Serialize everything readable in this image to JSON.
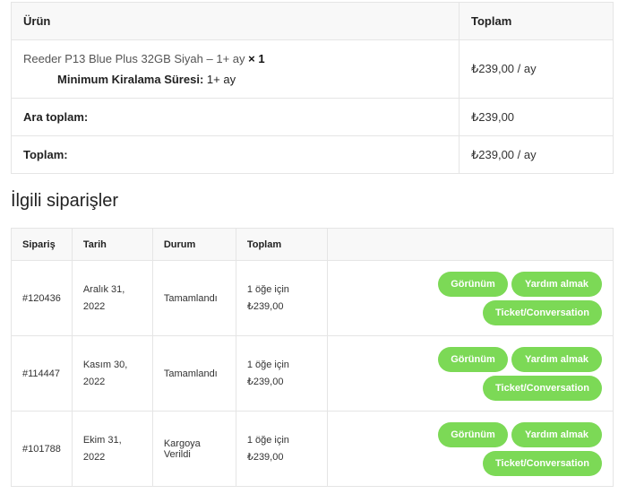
{
  "order": {
    "header": {
      "product": "Ürün",
      "total": "Toplam"
    },
    "item": {
      "name": "Reeder P13 Blue Plus 32GB Siyah – 1+ ay",
      "qty": "× 1",
      "meta_key": "Minimum Kiralama Süresi:",
      "meta_value": "1+ ay",
      "total": "₺239,00 / ay"
    },
    "subtotal": {
      "label": "Ara toplam:",
      "value": "₺239,00"
    },
    "total": {
      "label": "Toplam:",
      "value": "₺239,00 / ay"
    }
  },
  "related": {
    "title": "İlgili siparişler",
    "headers": {
      "order": "Sipariş",
      "date": "Tarih",
      "status": "Durum",
      "total": "Toplam"
    },
    "buttons": {
      "view": "Görünüm",
      "help": "Yardım almak",
      "ticket": "Ticket/Conversation"
    },
    "rows": [
      {
        "number": "#120436",
        "date_line1": "Aralık 31,",
        "date_line2": "2022",
        "status": "Tamamlandı",
        "items": "1 öğe için",
        "amount": "₺239,00"
      },
      {
        "number": "#114447",
        "date_line1": "Kasım 30,",
        "date_line2": "2022",
        "status": "Tamamlandı",
        "items": "1 öğe için",
        "amount": "₺239,00"
      },
      {
        "number": "#101788",
        "date_line1": "Ekim 31, 2022",
        "date_line2": "",
        "status": "Kargoya Verildi",
        "items": "1 öğe için",
        "amount": "₺239,00"
      }
    ]
  },
  "colors": {
    "button": "#7cd956",
    "border": "#e5e5e5",
    "header_bg": "#f8f8f8"
  }
}
